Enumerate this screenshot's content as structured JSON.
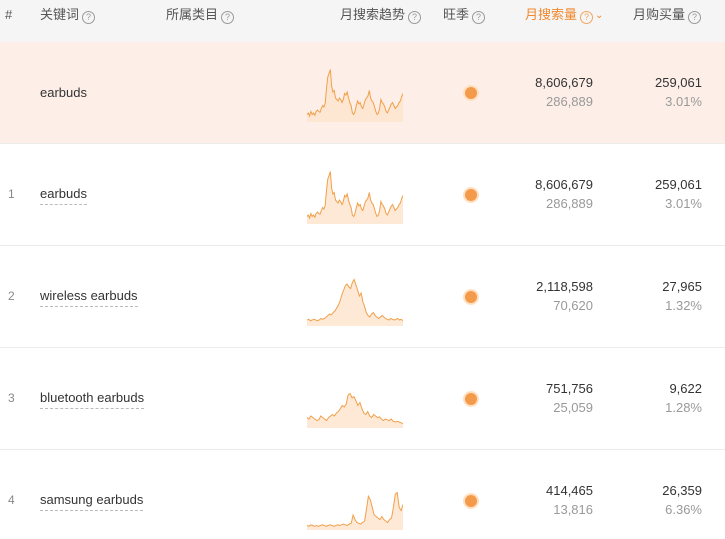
{
  "header": {
    "index": "#",
    "keyword": "关键词",
    "category": "所属类目",
    "trend": "月搜索趋势",
    "season": "旺季",
    "monthly_search": "月搜索量",
    "monthly_purchase": "月购买量",
    "help_glyph": "?",
    "sort_glyph": "⌄"
  },
  "colors": {
    "accent": "#f0892d",
    "highlight_row": "#fdefe8",
    "season_dot": "#f39a4b",
    "spark_stroke": "#f0a04b",
    "spark_fill": "#fde3cc"
  },
  "rows": [
    {
      "index": "",
      "keyword": "earbuds",
      "monthly_search": "8,606,679",
      "search_sub": "286,889",
      "monthly_purchase": "259,061",
      "purchase_rate": "3.01%",
      "highlight": true,
      "trend": [
        10,
        12,
        8,
        14,
        10,
        12,
        9,
        14,
        16,
        14,
        13,
        18,
        22,
        20,
        25,
        45,
        60,
        65,
        70,
        48,
        40,
        42,
        32,
        30,
        28,
        32,
        30,
        26,
        30,
        38,
        36,
        40,
        32,
        26,
        22,
        12,
        10,
        14,
        22,
        28,
        24,
        26,
        20,
        18,
        24,
        30,
        32,
        35,
        42,
        32,
        28,
        26,
        20,
        14,
        10,
        12,
        18,
        30,
        26,
        24,
        20,
        14,
        12,
        16,
        20,
        24,
        26,
        22,
        18,
        20,
        22,
        26,
        28,
        34,
        38
      ]
    },
    {
      "index": "1",
      "keyword": "earbuds",
      "monthly_search": "8,606,679",
      "search_sub": "286,889",
      "monthly_purchase": "259,061",
      "purchase_rate": "3.01%",
      "highlight": false,
      "trend": [
        10,
        12,
        8,
        14,
        10,
        12,
        9,
        14,
        16,
        14,
        13,
        18,
        22,
        20,
        25,
        45,
        60,
        65,
        70,
        48,
        40,
        42,
        32,
        30,
        28,
        32,
        30,
        26,
        30,
        38,
        36,
        40,
        32,
        26,
        22,
        12,
        10,
        14,
        22,
        28,
        24,
        26,
        20,
        18,
        24,
        30,
        32,
        35,
        42,
        32,
        28,
        26,
        20,
        14,
        10,
        12,
        18,
        30,
        26,
        24,
        20,
        14,
        12,
        16,
        20,
        24,
        26,
        22,
        18,
        20,
        22,
        26,
        28,
        34,
        38
      ]
    },
    {
      "index": "2",
      "keyword": "wireless earbuds",
      "monthly_search": "2,118,598",
      "search_sub": "70,620",
      "monthly_purchase": "27,965",
      "purchase_rate": "1.32%",
      "highlight": false,
      "trend": [
        8,
        9,
        7,
        8,
        9,
        8,
        7,
        8,
        10,
        9,
        10,
        12,
        14,
        16,
        15,
        18,
        20,
        24,
        28,
        34,
        42,
        48,
        54,
        56,
        52,
        50,
        58,
        62,
        55,
        48,
        40,
        44,
        32,
        26,
        18,
        14,
        12,
        16,
        18,
        14,
        12,
        10,
        12,
        14,
        12,
        10,
        9,
        8,
        10,
        9,
        8,
        9,
        10,
        8,
        9,
        7
      ]
    },
    {
      "index": "3",
      "keyword": "bluetooth earbuds",
      "monthly_search": "751,756",
      "search_sub": "25,059",
      "monthly_purchase": "9,622",
      "purchase_rate": "1.28%",
      "highlight": false,
      "trend": [
        14,
        12,
        16,
        14,
        12,
        10,
        11,
        16,
        14,
        12,
        10,
        14,
        16,
        18,
        16,
        20,
        22,
        26,
        30,
        28,
        32,
        44,
        46,
        40,
        42,
        36,
        30,
        34,
        26,
        20,
        18,
        22,
        16,
        14,
        18,
        16,
        14,
        15,
        12,
        10,
        12,
        11,
        10,
        12,
        9,
        8,
        9,
        8,
        7,
        6
      ]
    },
    {
      "index": "4",
      "keyword": "samsung earbuds",
      "monthly_search": "414,465",
      "search_sub": "13,816",
      "monthly_purchase": "26,359",
      "purchase_rate": "6.36%",
      "highlight": false,
      "trend": [
        6,
        5,
        7,
        6,
        5,
        6,
        5,
        6,
        7,
        6,
        5,
        6,
        7,
        6,
        5,
        6,
        7,
        6,
        7,
        8,
        7,
        6,
        8,
        9,
        20,
        14,
        10,
        9,
        8,
        10,
        12,
        28,
        45,
        40,
        30,
        20,
        18,
        16,
        14,
        18,
        14,
        12,
        10,
        14,
        16,
        30,
        48,
        50,
        30,
        26,
        34
      ]
    }
  ]
}
